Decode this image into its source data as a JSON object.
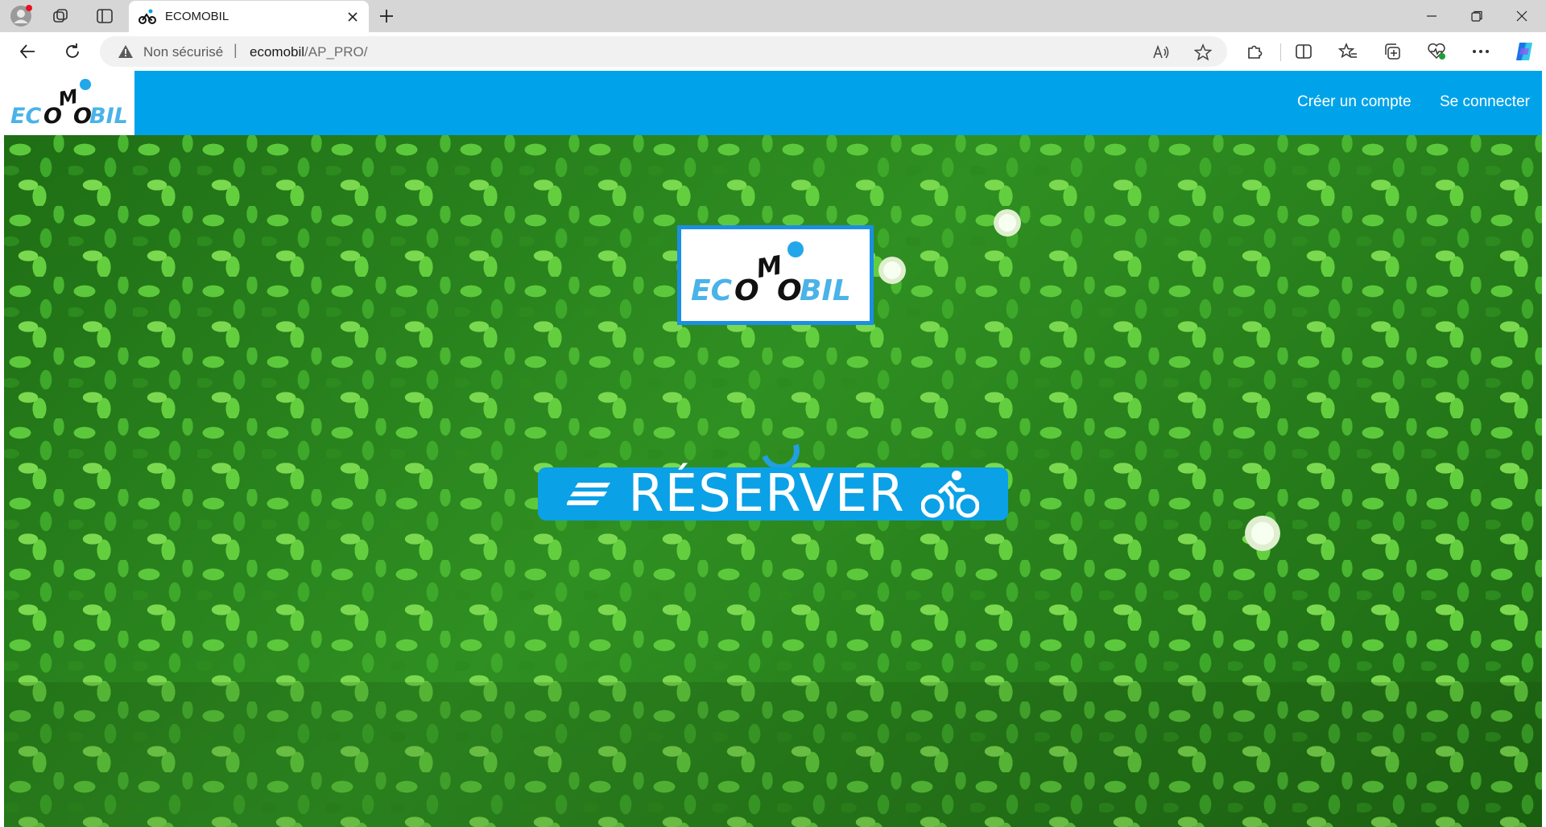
{
  "browser": {
    "tab": {
      "title": "ECOMOBIL"
    },
    "address": {
      "security_label": "Non sécurisé",
      "url_host": "ecomobil",
      "url_path": "/AP_PRO/"
    }
  },
  "site": {
    "logo_text": {
      "part1": "EC",
      "o1": "O",
      "m": "M",
      "o2": "O",
      "part2": "BIL"
    },
    "nav": [
      {
        "label": "Créer un compte"
      },
      {
        "label": "Se connecter"
      }
    ],
    "hero": {
      "button_label": "RÉSERVER"
    }
  },
  "colors": {
    "brand_blue": "#00a3ea",
    "logo_light_blue": "#4ab3e8",
    "logo_dark": "#111111",
    "leaf_green": "#2f8a22"
  },
  "icons": [
    "profile-icon",
    "workspaces-icon",
    "tab-actions-icon",
    "bike-favicon",
    "close-icon",
    "plus-icon",
    "minimize-icon",
    "restore-icon",
    "window-close-icon",
    "back-icon",
    "refresh-icon",
    "warning-icon",
    "read-aloud-icon",
    "favorite-star-icon",
    "extensions-icon",
    "split-screen-icon",
    "favorites-icon",
    "collections-icon",
    "browser-essentials-icon",
    "more-icon",
    "copilot-icon",
    "menu-lines-icon",
    "cyclist-icon"
  ]
}
